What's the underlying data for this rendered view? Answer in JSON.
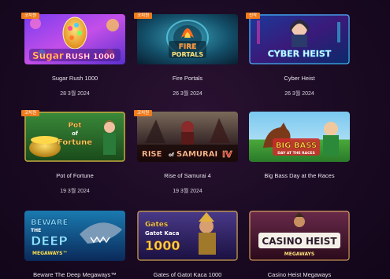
{
  "games": [
    {
      "title": "Sugar Rush 1000",
      "date": "28 3월 2024",
      "badge": "코치원",
      "logo": [
        "Sugar",
        "RUSH 1000"
      ]
    },
    {
      "title": "Fire Portals",
      "date": "26 3월 2024",
      "badge": "코치원",
      "logo": [
        "FIRE",
        "PORTALS"
      ]
    },
    {
      "title": "Cyber Heist",
      "date": "26 3월 2024",
      "badge": "신작",
      "logo": [
        "CYBER",
        "HEIST"
      ]
    },
    {
      "title": "Pot of Fortune",
      "date": "19 3월 2024",
      "badge": "코치원",
      "logo": [
        "Pot",
        "of",
        "Fortune"
      ]
    },
    {
      "title": "Rise of Samurai 4",
      "date": "19 3월 2024",
      "badge": "코치원",
      "logo": [
        "RISE",
        "of",
        "SAMURAI",
        "IV"
      ]
    },
    {
      "title": "Big Bass Day at the Races",
      "date": "",
      "badge": "",
      "logo": [
        "BIG BASS",
        "DAY AT THE RACES"
      ]
    },
    {
      "title": "Beware The Deep Megaways™",
      "date": "",
      "badge": "",
      "logo": [
        "BEWARE",
        "THE",
        "DEEP",
        "MEGAWAYS™"
      ]
    },
    {
      "title": "Gates of Gatot Kaca 1000",
      "date": "",
      "badge": "",
      "logo": [
        "Gates",
        "Gatot Kaca",
        "1000"
      ]
    },
    {
      "title": "Casino Heist Megaways",
      "date": "",
      "badge": "",
      "logo": [
        "CASINO HEIST",
        "MEGAWAYS"
      ]
    }
  ],
  "colors": {
    "badge": "#f07b1c",
    "background": "#1a0a22",
    "text": "#e9e4ee"
  }
}
